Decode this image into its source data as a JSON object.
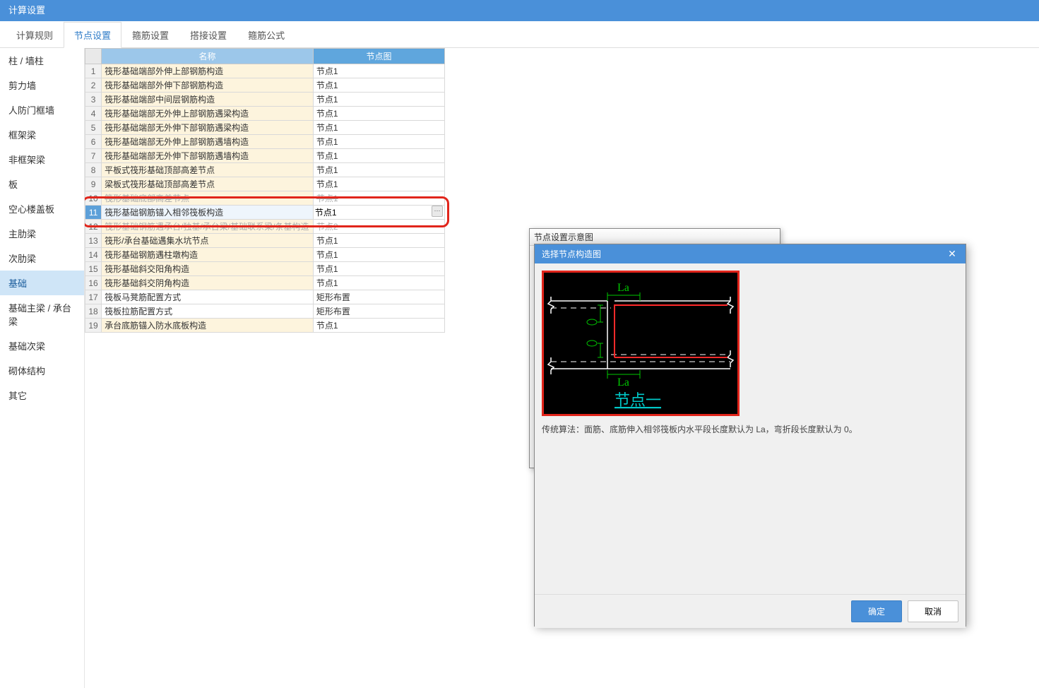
{
  "window": {
    "title": "计算设置"
  },
  "tabs": [
    "计算规则",
    "节点设置",
    "箍筋设置",
    "搭接设置",
    "箍筋公式"
  ],
  "activeTab": 1,
  "sidebar": {
    "items": [
      "柱 / 墙柱",
      "剪力墙",
      "人防门框墙",
      "框架梁",
      "非框架梁",
      "板",
      "空心楼盖板",
      "主肋梁",
      "次肋梁",
      "基础",
      "基础主梁 / 承台梁",
      "基础次梁",
      "砌体结构",
      "其它"
    ],
    "activeIndex": 9
  },
  "grid": {
    "headers": {
      "name": "名称",
      "node": "节点图"
    },
    "rows": [
      {
        "idx": 1,
        "name": "筏形基础端部外伸上部钢筋构造",
        "node": "节点1",
        "yellow": true
      },
      {
        "idx": 2,
        "name": "筏形基础端部外伸下部钢筋构造",
        "node": "节点1",
        "yellow": true
      },
      {
        "idx": 3,
        "name": "筏形基础端部中间层钢筋构造",
        "node": "节点1",
        "yellow": true
      },
      {
        "idx": 4,
        "name": "筏形基础端部无外伸上部钢筋遇梁构造",
        "node": "节点1",
        "yellow": true
      },
      {
        "idx": 5,
        "name": "筏形基础端部无外伸下部钢筋遇梁构造",
        "node": "节点1",
        "yellow": true
      },
      {
        "idx": 6,
        "name": "筏形基础端部无外伸上部钢筋遇墙构造",
        "node": "节点1",
        "yellow": true
      },
      {
        "idx": 7,
        "name": "筏形基础端部无外伸下部钢筋遇墙构造",
        "node": "节点1",
        "yellow": true
      },
      {
        "idx": 8,
        "name": "平板式筏形基础顶部高差节点",
        "node": "节点1",
        "yellow": true
      },
      {
        "idx": 9,
        "name": "梁板式筏形基础顶部高差节点",
        "node": "节点1",
        "yellow": true
      },
      {
        "idx": 10,
        "name": "筏形基础底部高差节点",
        "node": "节点1",
        "yellow": true,
        "struck": true
      },
      {
        "idx": 11,
        "name": "筏形基础钢筋锚入相邻筏板构造",
        "node": "节点1",
        "yellow": true,
        "selected": true,
        "editor": true
      },
      {
        "idx": 12,
        "name": "筏形基础钢筋遇承台/独基/承台梁/基础联系梁/条基构造",
        "node": "节点2",
        "yellow": true,
        "struck": true
      },
      {
        "idx": 13,
        "name": "筏形/承台基础遇集水坑节点",
        "node": "节点1",
        "yellow": true
      },
      {
        "idx": 14,
        "name": "筏形基础钢筋遇柱墩构造",
        "node": "节点1",
        "yellow": true
      },
      {
        "idx": 15,
        "name": "筏形基础斜交阳角构造",
        "node": "节点1",
        "yellow": true
      },
      {
        "idx": 16,
        "name": "筏形基础斜交阴角构造",
        "node": "节点1",
        "yellow": true
      },
      {
        "idx": 17,
        "name": "筏板马凳筋配置方式",
        "node": "矩形布置",
        "yellow": false
      },
      {
        "idx": 18,
        "name": "筏板拉筋配置方式",
        "node": "矩形布置",
        "yellow": false
      },
      {
        "idx": 19,
        "name": "承台底筋锚入防水底板构造",
        "node": "节点1",
        "yellow": true
      }
    ]
  },
  "popup1": {
    "title": "节点设置示意图"
  },
  "dialog": {
    "title": "选择节点构造图",
    "la_top": "La",
    "la_bottom": "La",
    "node_label": "节点一",
    "caption": "传统算法：面筋、底筋伸入相邻筏板内水平段长度默认为 La，弯折段长度默认为 0。",
    "ok": "确定",
    "cancel": "取消"
  }
}
